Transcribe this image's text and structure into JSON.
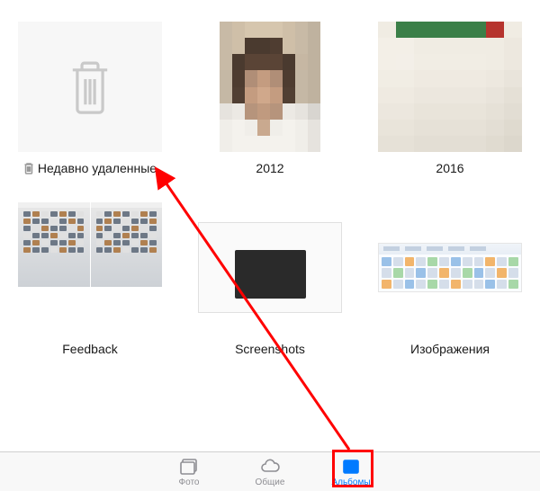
{
  "albums": [
    {
      "label": "Недавно удаленные",
      "type": "recently-deleted"
    },
    {
      "label": "2012",
      "type": "photo-person"
    },
    {
      "label": "2016",
      "type": "photo-abstract"
    },
    {
      "label": "Feedback",
      "type": "desktop"
    },
    {
      "label": "Screenshots",
      "type": "screenshot"
    },
    {
      "label": "Изображения",
      "type": "ribbon"
    }
  ],
  "tabs": {
    "photos": "Фото",
    "shared": "Общие",
    "albums": "Альбомы"
  },
  "annotation": {
    "arrow_from_tab": "albums",
    "arrow_to_album": "Недавно удаленные",
    "highlight_tab": "albums"
  }
}
